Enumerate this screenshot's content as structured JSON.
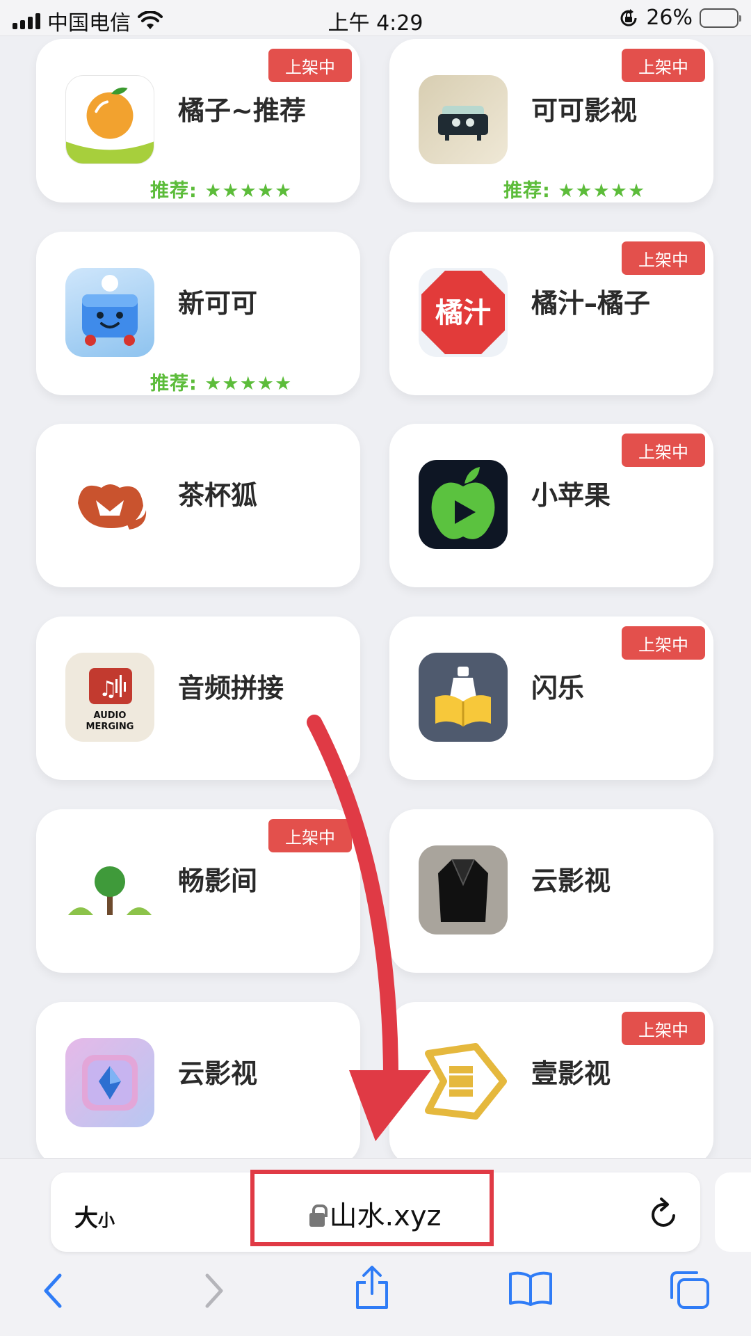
{
  "status_bar": {
    "carrier": "中国电信",
    "time": "上午 4:29",
    "battery": "26%"
  },
  "badge_text": "上架中",
  "rating_label": "推荐: ★★★★★",
  "apps": [
    {
      "name": "橘子~推荐",
      "icon": "orange-icon",
      "badge": true,
      "rating": true
    },
    {
      "name": "可可影视",
      "icon": "retro-tv-icon",
      "badge": true,
      "rating": true
    },
    {
      "name": "新可可",
      "icon": "cooler-mascot-icon",
      "badge": false,
      "rating": true
    },
    {
      "name": "橘汁–橘子",
      "icon": "juzhi-text-icon",
      "icon_text": "橘汁",
      "badge": true,
      "rating": false
    },
    {
      "name": "茶杯狐",
      "icon": "fox-icon",
      "badge": false,
      "rating": false
    },
    {
      "name": "小苹果",
      "icon": "green-apple-play-icon",
      "badge": true,
      "rating": false
    },
    {
      "name": "音频拼接",
      "icon": "audio-merging-icon",
      "icon_text": "AUDIO MERGING",
      "badge": false,
      "rating": false
    },
    {
      "name": "闪乐",
      "icon": "book-bottle-icon",
      "badge": true,
      "rating": false
    },
    {
      "name": "畅影间",
      "icon": "tree-icon",
      "badge": true,
      "rating": false
    },
    {
      "name": "云影视",
      "icon": "black-jacket-icon",
      "badge": false,
      "rating": false
    },
    {
      "name": "云影视",
      "icon": "crystal-gem-icon",
      "badge": false,
      "rating": false
    },
    {
      "name": "壹影视",
      "icon": "film-strip-play-icon",
      "badge": true,
      "rating": false
    }
  ],
  "browser": {
    "text_size_label_big": "大",
    "text_size_label_small": "小",
    "url": "山水.xyz"
  },
  "colors": {
    "badge": "#e3504c",
    "rating": "#5cbc3a",
    "annotation": "#e03a45",
    "ios_blue": "#2f7cf6"
  }
}
